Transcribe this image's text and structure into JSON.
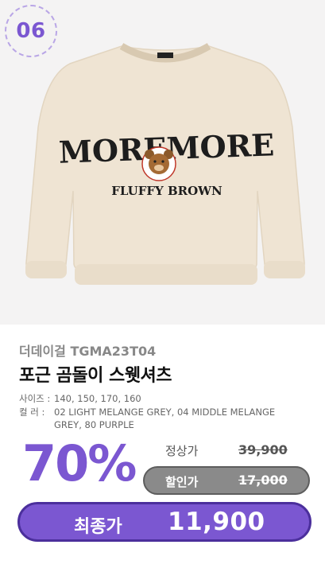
{
  "badge": {
    "number": "06"
  },
  "product": {
    "brand": "더데이걸 TGMA23T04",
    "name": "포근 곰돌이 스웻셔츠",
    "graphic": {
      "word": "MOREMORE",
      "subword": "FLUFFY BROWN"
    },
    "specs": {
      "size_label": "사이즈 :",
      "size_value": "140, 150, 170, 160",
      "color_label": "컬    러 :",
      "color_value": "02 LIGHT MELANGE GREY, 04 MIDDLE MELANGE GREY, 80 PURPLE"
    }
  },
  "pricing": {
    "discount_percent": "70%",
    "regular_label": "정상가",
    "regular_price": "39,900",
    "sale_label": "할인가",
    "sale_price": "17,000",
    "final_label": "최종가",
    "final_price": "11,900"
  },
  "colors": {
    "accent": "#7b57d1",
    "accent_dark": "#4b2f9c",
    "pill_grey": "#8a8a8a"
  }
}
